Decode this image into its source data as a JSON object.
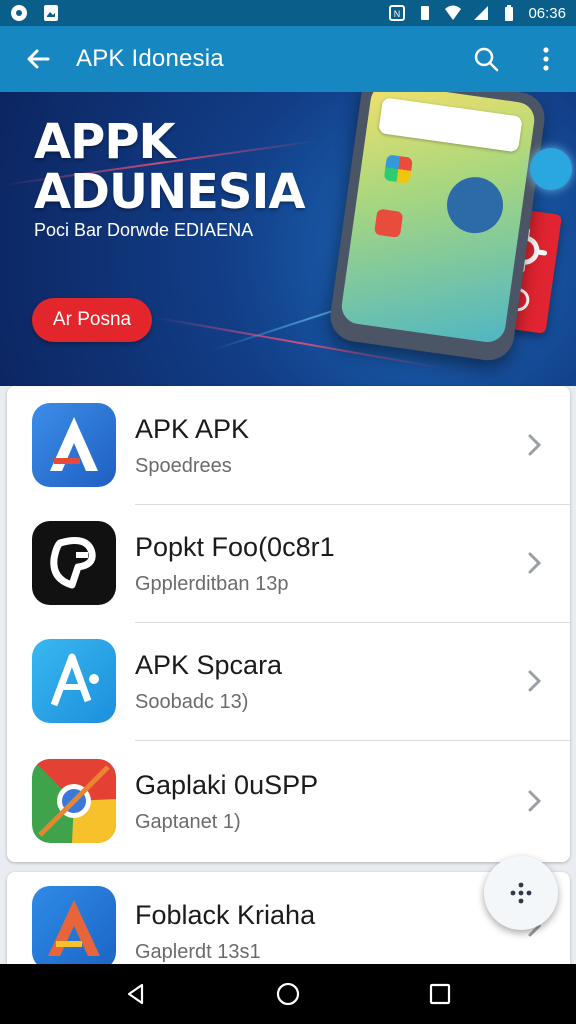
{
  "status_bar": {
    "time": "06:36",
    "left_icons": [
      "soccer-ball-icon",
      "image-icon"
    ],
    "right_icons": [
      "nfc-icon",
      "vibrate-icon",
      "wifi-icon",
      "signal-icon",
      "battery-icon"
    ]
  },
  "app_bar": {
    "title": "APK Idonesia",
    "background": "#1787c2",
    "icons": [
      "back-arrow-icon",
      "search-icon",
      "more-vert-icon"
    ]
  },
  "banner": {
    "headline_line1": "APPK",
    "headline_line2": "ADUNESIA",
    "subtitle": "Poci Bar Dorwde EDIAENA",
    "button_label": "Ar Posna",
    "button_color": "#e3262b"
  },
  "app_list": [
    {
      "name": "APK APK",
      "meta": "Spoedrees",
      "icon": "triangle-a-icon"
    },
    {
      "name": "Popkt Foo(0c8r1",
      "meta": "Gpplerditban 13p",
      "icon": "black-swirl-icon"
    },
    {
      "name": "APK Spcara",
      "meta": "Soobadc 13)",
      "icon": "blue-a-icon"
    },
    {
      "name": "Gaplaki 0uSPP",
      "meta": "Gaptanet 1)",
      "icon": "chrome-icon"
    },
    {
      "name": "Foblack Kriaha",
      "meta": "Gaplerdt 13s1",
      "icon": "colored-a-icon"
    }
  ],
  "fab": {
    "icon": "dots-grid-icon"
  },
  "nav_bar": {
    "icons": [
      "back-triangle-icon",
      "home-circle-icon",
      "recents-square-icon"
    ]
  }
}
